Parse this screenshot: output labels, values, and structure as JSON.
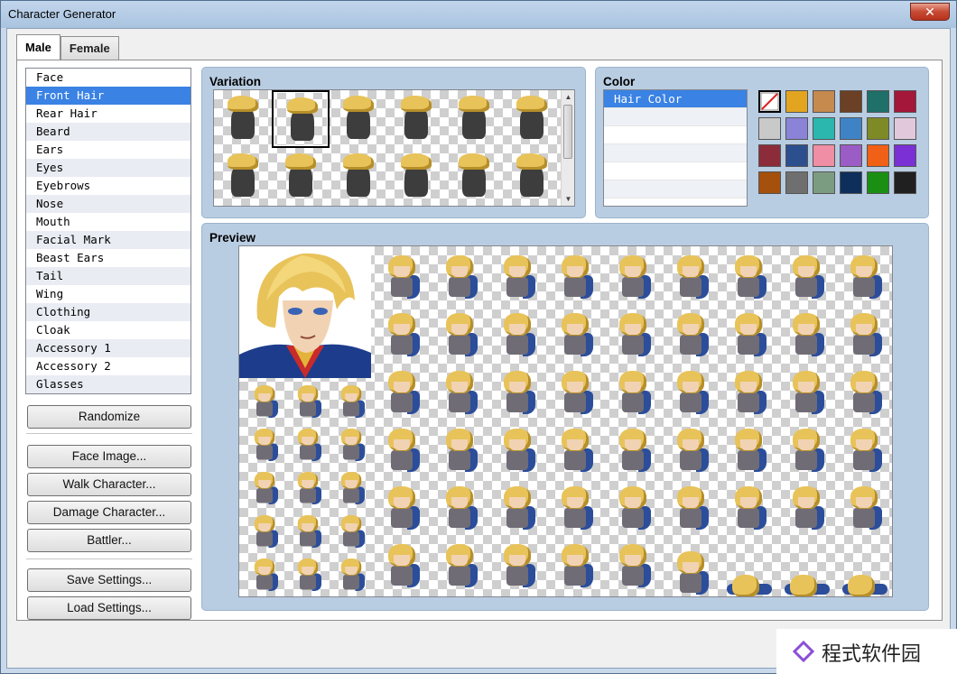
{
  "window": {
    "title": "Character Generator",
    "close_glyph": "✕"
  },
  "tabs": [
    {
      "label": "Male",
      "active": true
    },
    {
      "label": "Female",
      "active": false
    }
  ],
  "parts": [
    {
      "label": "Face"
    },
    {
      "label": "Front Hair",
      "selected": true
    },
    {
      "label": "Rear Hair"
    },
    {
      "label": "Beard"
    },
    {
      "label": "Ears"
    },
    {
      "label": "Eyes"
    },
    {
      "label": "Eyebrows"
    },
    {
      "label": "Nose"
    },
    {
      "label": "Mouth"
    },
    {
      "label": "Facial Mark"
    },
    {
      "label": "Beast Ears"
    },
    {
      "label": "Tail"
    },
    {
      "label": "Wing"
    },
    {
      "label": "Clothing"
    },
    {
      "label": "Cloak"
    },
    {
      "label": "Accessory 1"
    },
    {
      "label": "Accessory 2"
    },
    {
      "label": "Glasses"
    }
  ],
  "buttons": {
    "randomize": "Randomize",
    "face_image": "Face Image...",
    "walk_character": "Walk Character...",
    "damage_character": "Damage Character...",
    "battler": "Battler...",
    "save_settings": "Save Settings...",
    "load_settings": "Load Settings..."
  },
  "variation": {
    "title": "Variation",
    "selected_index": 1
  },
  "color": {
    "title": "Color",
    "items": [
      {
        "label": "Hair Color",
        "selected": true
      },
      {
        "label": ""
      },
      {
        "label": ""
      },
      {
        "label": ""
      },
      {
        "label": ""
      },
      {
        "label": ""
      }
    ],
    "swatches": [
      "none",
      "#e3a520",
      "#c78a4e",
      "#6b4024",
      "#1e7068",
      "#a4163a",
      "#c9c9c9",
      "#8a83d8",
      "#2cb7ae",
      "#3f83c7",
      "#7e8a26",
      "#e1c9db",
      "#8c2c3a",
      "#2c4f8e",
      "#ef8ea4",
      "#9b5cc6",
      "#f06016",
      "#7a30d4",
      "#a5500c",
      "#6f6f6f",
      "#7c9c82",
      "#0e2f5c",
      "#1a8f12",
      "#202020"
    ],
    "selected_swatch": 0
  },
  "preview": {
    "title": "Preview"
  },
  "watermark": {
    "text": "程式软件园"
  }
}
